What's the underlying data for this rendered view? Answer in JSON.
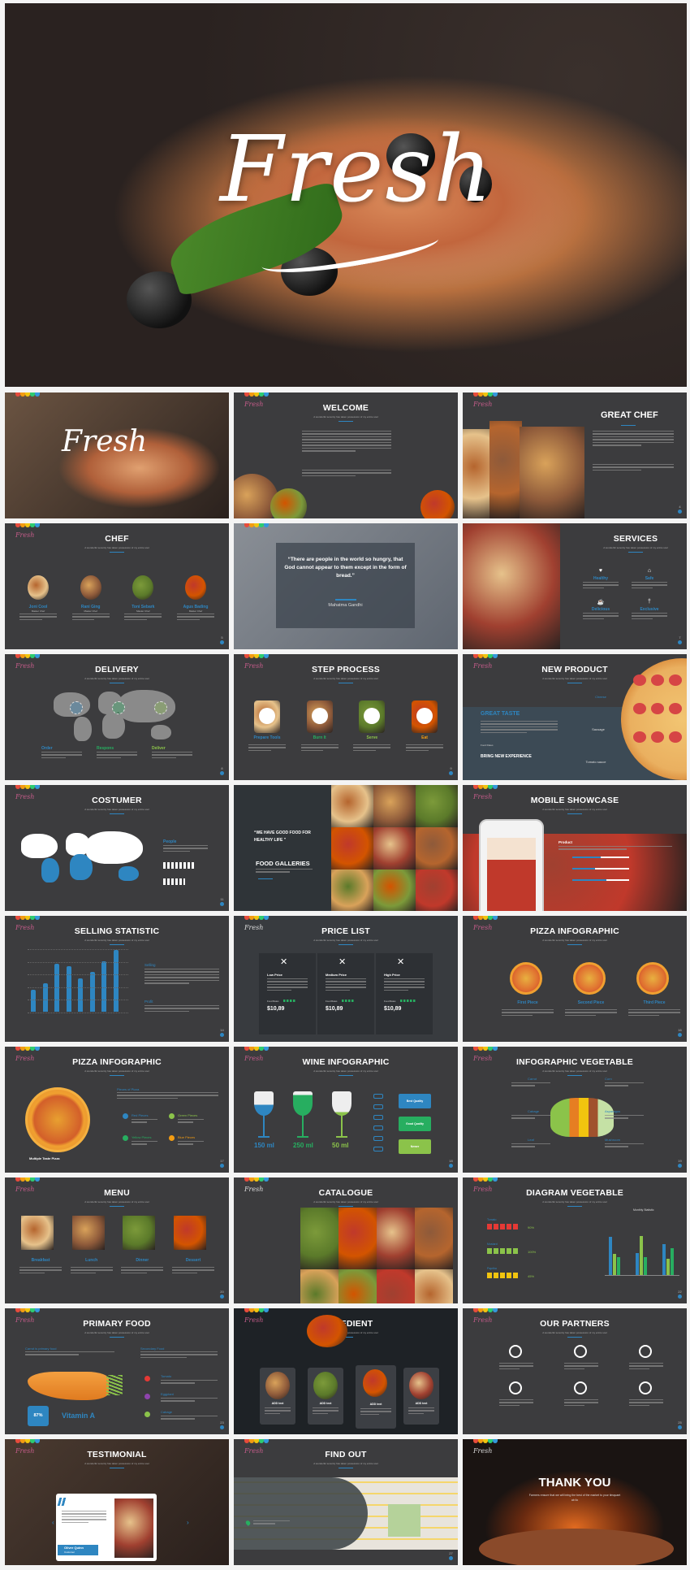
{
  "hero": {
    "title": "Fresh"
  },
  "rainbow": [
    "#e74c3c",
    "#f39c12",
    "#f1c40f",
    "#2ecc71",
    "#3498db"
  ],
  "accent": "#2e86c1",
  "logo": "Fresh",
  "subtitle": "A wonderful serenity has taken possession of my entire soul",
  "slides": [
    {
      "kind": "cover",
      "title": "Fresh"
    },
    {
      "kind": "welcome",
      "title": "WELCOME"
    },
    {
      "kind": "greatchef",
      "title": "GREAT CHEF",
      "page": "4"
    },
    {
      "kind": "row",
      "title": "CHEF",
      "page": "5",
      "shape": "circle",
      "items": [
        {
          "label": "Joni Cool",
          "sub": "Master Chef"
        },
        {
          "label": "Rani Ging",
          "sub": "Master Chef"
        },
        {
          "label": "Toni Sebark",
          "sub": "Master Chef"
        },
        {
          "label": "Agus Bading",
          "sub": "Master Chef"
        }
      ]
    },
    {
      "kind": "quote",
      "quote": "“There are people in the world so hungry, that God cannot appear to them except in the form of bread.”",
      "author": "Mahatma Gandhi"
    },
    {
      "kind": "services",
      "title": "SERVICES",
      "page": "7",
      "items": [
        {
          "label": "Healthy",
          "icon": "heart-icon",
          "glyph": "♥"
        },
        {
          "label": "Safe",
          "icon": "cloche-icon",
          "glyph": "⌂"
        },
        {
          "label": "Delicious",
          "icon": "cup-icon",
          "glyph": "☕"
        },
        {
          "label": "Exclusive",
          "icon": "cocktail-icon",
          "glyph": "†"
        }
      ]
    },
    {
      "kind": "delivery",
      "title": "DELIVERY",
      "page": "8",
      "items": [
        {
          "label": "Order",
          "color": "#2e86c1"
        },
        {
          "label": "Respons",
          "color": "#27ae60"
        },
        {
          "label": "Deliver",
          "color": "#8bc34a"
        }
      ]
    },
    {
      "kind": "row",
      "title": "STEP PROCESS",
      "page": "9",
      "shape": "step",
      "items": [
        {
          "label": "Prepare Tools",
          "color": "#2e86c1"
        },
        {
          "label": "Burn It",
          "color": "#27ae60"
        },
        {
          "label": "Serve",
          "color": "#8bc34a"
        },
        {
          "label": "Eat",
          "color": "#f39c12"
        }
      ]
    },
    {
      "kind": "product",
      "title": "NEW PRODUCT",
      "heading": "GREAT TASTE",
      "rate": "Food Rates",
      "cta": "BRING NEW EXPERIENCE",
      "labels": [
        "Cheese",
        "Sausage",
        "Tomato sauce"
      ]
    },
    {
      "kind": "costumer",
      "title": "COSTUMER",
      "page": "11",
      "label": "People"
    },
    {
      "kind": "gallery",
      "quote": "“WE HAVE GOOD FOOD FOR HEALTHY LIFE ”",
      "heading": "FOOD GALLERIES"
    },
    {
      "kind": "mobile",
      "title": "MOBILE SHOWCASE",
      "page": "13",
      "label": "Product"
    },
    {
      "kind": "selling",
      "title": "SELLING STATISTIC",
      "page": "14",
      "labels": [
        "Selling",
        "Profit"
      ],
      "bars": [
        35,
        45,
        76,
        72,
        52,
        63,
        80,
        98
      ]
    },
    {
      "kind": "price",
      "title": "PRICE LIST",
      "cards": [
        {
          "label": "Low Price",
          "price": "$10,89",
          "rate": "Food Rates",
          "stars": 4
        },
        {
          "label": "Medium Price",
          "price": "$10,89",
          "rate": "Food Rates",
          "stars": 4
        },
        {
          "label": "High Price",
          "price": "$10,89",
          "rate": "Food Rates",
          "stars": 5
        }
      ]
    },
    {
      "kind": "row",
      "title": "PIZZA INFOGRAPHIC",
      "page": "16",
      "shape": "pizza",
      "items": [
        {
          "label": "First Piece"
        },
        {
          "label": "Second Piece"
        },
        {
          "label": "Third Piece"
        }
      ]
    },
    {
      "kind": "pieces",
      "title": "PIZZA INFOGRAPHIC",
      "page": "17",
      "heading": "Pieces of Pizza",
      "caption": "Multiple Taste Pizza",
      "items": [
        {
          "label": "Red Pieces",
          "color": "#2e86c1"
        },
        {
          "label": "Green Pieces",
          "color": "#8bc34a"
        },
        {
          "label": "Yellow Pieces",
          "color": "#27ae60"
        },
        {
          "label": "Blue Pieces",
          "color": "#f39c12"
        }
      ]
    },
    {
      "kind": "wine",
      "title": "WINE INFOGRAPHIC",
      "page": "18",
      "glasses": [
        {
          "label": "150 ml",
          "color": "#2e86c1",
          "fill": 0.45
        },
        {
          "label": "250 ml",
          "color": "#27ae60",
          "fill": 0.85
        },
        {
          "label": "50 ml",
          "color": "#8bc34a",
          "fill": 0.15
        }
      ],
      "buttons": [
        {
          "label": "Best Quality",
          "color": "#2e86c1"
        },
        {
          "label": "Good Quality",
          "color": "#27ae60"
        },
        {
          "label": "Newer",
          "color": "#8bc34a"
        }
      ]
    },
    {
      "kind": "veg",
      "title": "INFOGRAPHIC VEGETABLE",
      "page": "19",
      "labels": [
        "Carrot",
        "Corn",
        "Cabage",
        "Asparagus",
        "Leaf",
        "Mushroom"
      ]
    },
    {
      "kind": "row",
      "title": "MENU",
      "page": "20",
      "shape": "rect",
      "items": [
        {
          "label": "Breakfast"
        },
        {
          "label": "Lunch"
        },
        {
          "label": "Dinner"
        },
        {
          "label": "Dessert"
        }
      ]
    },
    {
      "kind": "catalogue",
      "title": "CATALOGUE"
    },
    {
      "kind": "diagram",
      "title": "DIAGRAM VEGETABLE",
      "page": "22",
      "chart_title": "Monthly Statistic",
      "rows": [
        {
          "label": "Tomato",
          "pct": "90%"
        },
        {
          "label": "Mustard",
          "pct": "100%"
        },
        {
          "label": "Paprika",
          "pct": "45%"
        }
      ],
      "series": [
        [
          4.3,
          2.5,
          3.5,
          4.5
        ],
        [
          2.4,
          4.4,
          1.8,
          2.8
        ],
        [
          2,
          2,
          3,
          5
        ]
      ]
    },
    {
      "kind": "primary",
      "title": "PRIMARY FOOD",
      "page": "23",
      "heading1": "Carrot is primary food",
      "heading2": "Secondary Food",
      "items": [
        "Tomato",
        "Eggplant",
        "Cabage"
      ],
      "pct": "87%",
      "vitamin": "Vitamin A"
    },
    {
      "kind": "ingredient",
      "title": "INGREDIENT",
      "cards": [
        "ADD text",
        "ADD text",
        "ADD text",
        "ADD text"
      ]
    },
    {
      "kind": "partners",
      "title": "OUR PARTNERS",
      "page": "25"
    },
    {
      "kind": "testimonial",
      "title": "TESTIMONIAL",
      "name": "Oliver Quinn",
      "role": "Costumer"
    },
    {
      "kind": "findout",
      "title": "FIND OUT",
      "page": "27"
    },
    {
      "kind": "thanks",
      "title": "THANK YOU",
      "text": "Farmers ensure that we will bring the best of the market to your timquaet ab ilo"
    }
  ]
}
